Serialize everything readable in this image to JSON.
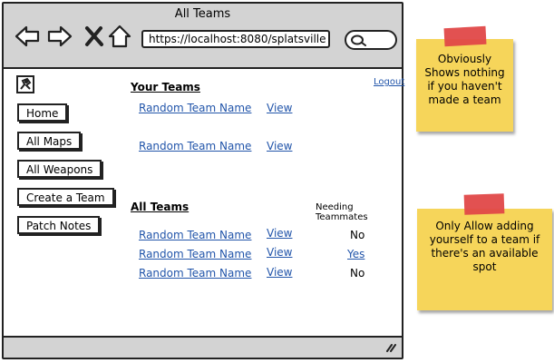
{
  "window": {
    "title": "All Teams",
    "url": "https://localhost:8080/splatsville"
  },
  "header": {
    "logout_label": "Logout"
  },
  "sidebar": {
    "buttons": [
      "Home",
      "All Maps",
      "All Weapons",
      "Create a Team",
      "Patch Notes"
    ]
  },
  "your_teams": {
    "title": "Your Teams",
    "rows": [
      {
        "name": "Random Team Name",
        "action": "View"
      },
      {
        "name": "Random Team Name",
        "action": "View"
      }
    ]
  },
  "all_teams": {
    "title": "All Teams",
    "needs_header": "Needing Teammates",
    "rows": [
      {
        "name": "Random Team Name",
        "action": "View",
        "needs": "No"
      },
      {
        "name": "Random Team Name",
        "action": "View",
        "needs": "Yes"
      },
      {
        "name": "Random Team Name",
        "action": "View",
        "needs": "No"
      }
    ]
  },
  "notes": [
    {
      "text": "Obviously Shows nothing if you haven't made a team"
    },
    {
      "text": "Only Allow adding yourself to a team if there's an available spot"
    }
  ],
  "colors": {
    "note": "#f6d55a",
    "tape": "#e04848",
    "link": "#2255aa",
    "chrome": "#d3d3d3"
  }
}
